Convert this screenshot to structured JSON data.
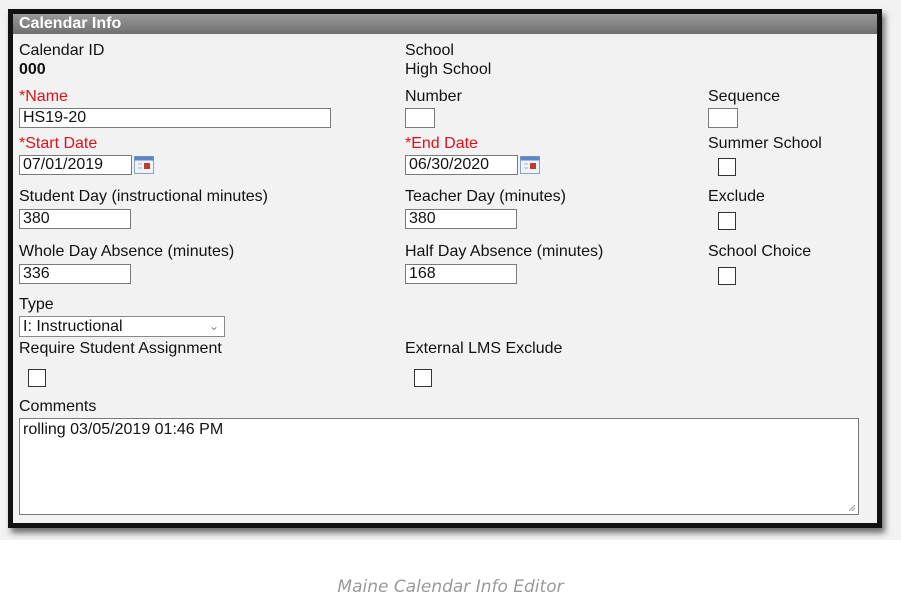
{
  "panel": {
    "title": "Calendar Info"
  },
  "calendar_id": {
    "label": "Calendar ID",
    "value": "000"
  },
  "school": {
    "label": "School",
    "value": "High School"
  },
  "name": {
    "required_mark": "*",
    "label": "Name",
    "value": "HS19-20"
  },
  "number": {
    "label": "Number",
    "value": ""
  },
  "sequence": {
    "label": "Sequence",
    "value": ""
  },
  "start_date": {
    "required_mark": "*",
    "label": "Start Date",
    "value": "07/01/2019"
  },
  "end_date": {
    "required_mark": "*",
    "label": "End Date",
    "value": "06/30/2020"
  },
  "summer_school": {
    "label": "Summer School",
    "checked": false
  },
  "student_day": {
    "label": "Student Day (instructional minutes)",
    "value": "380"
  },
  "teacher_day": {
    "label": "Teacher Day (minutes)",
    "value": "380"
  },
  "exclude": {
    "label": "Exclude",
    "checked": false
  },
  "whole_day_absence": {
    "label": "Whole Day Absence (minutes)",
    "value": "336"
  },
  "half_day_absence": {
    "label": "Half Day Absence (minutes)",
    "value": "168"
  },
  "school_choice": {
    "label": "School Choice",
    "checked": false
  },
  "type": {
    "label": "Type",
    "selected": "I: Instructional"
  },
  "require_student_assignment": {
    "label": "Require Student Assignment",
    "checked": false
  },
  "external_lms_exclude": {
    "label": "External LMS Exclude",
    "checked": false
  },
  "comments": {
    "label": "Comments",
    "value": "rolling 03/05/2019 01:46 PM"
  },
  "caption": "Maine Calendar Info Editor",
  "icons": {
    "date_picker": "calendar-icon",
    "select": "chevron-down-icon",
    "resize": "resize-grip-icon"
  },
  "colors": {
    "required": "#e0101a",
    "header_bg": "#7d7d7d",
    "panel_bg": "#f2f2f2"
  }
}
